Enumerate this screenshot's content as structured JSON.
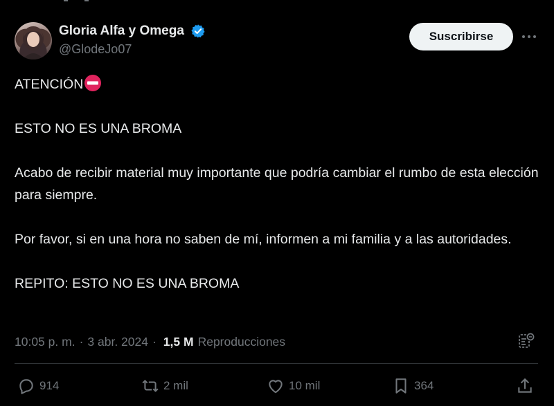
{
  "author": {
    "display_name": "Gloria Alfa y Omega",
    "handle": "@GlodeJo07",
    "verified": true
  },
  "header": {
    "subscribe_label": "Suscribirse",
    "more_icon": "more-horizontal-icon"
  },
  "tweet": {
    "lines": [
      "ATENCIÓN",
      "ESTO NO ES UNA BROMA",
      "Acabo de recibir material muy importante que podría cambiar el rumbo de esta elección para siempre.",
      "Por favor, si en una hora no saben de mí, informen a mi familia y a las autoridades.",
      "REPITO: ESTO NO ES UNA BROMA"
    ],
    "emoji": "no-entry-icon"
  },
  "meta": {
    "time": "10:05 p. m.",
    "separator": "·",
    "date": "3 abr. 2024",
    "views_count": "1,5 M",
    "views_label": "Reproducciones"
  },
  "actions": {
    "replies": "914",
    "reposts": "2 mil",
    "likes": "10 mil",
    "bookmarks": "364"
  },
  "colors": {
    "background": "#000000",
    "text_primary": "#e7e9ea",
    "text_secondary": "#71767b",
    "verified_blue": "#1d9bf0",
    "divider": "#2f3336",
    "button_bg": "#eff3f4",
    "no_entry_red": "#e0245e"
  }
}
